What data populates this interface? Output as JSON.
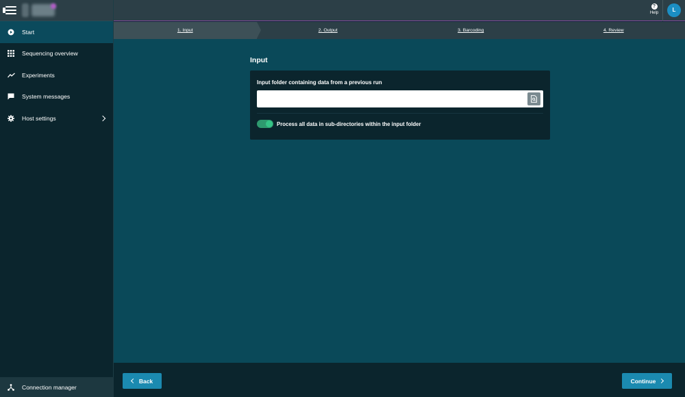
{
  "app": {
    "logo_icon": "blurred-logo"
  },
  "sidebar": {
    "items": [
      {
        "label": "Start",
        "icon": "play-circle-icon",
        "active": true
      },
      {
        "label": "Sequencing overview",
        "icon": "grid-icon"
      },
      {
        "label": "Experiments",
        "icon": "trend-line-icon"
      },
      {
        "label": "System messages",
        "icon": "chat-icon"
      },
      {
        "label": "Host settings",
        "icon": "gear-icon",
        "has_submenu": true
      }
    ],
    "bottom": {
      "label": "Connection manager",
      "icon": "network-icon"
    }
  },
  "header": {
    "help_label": "Help",
    "avatar_initial": "L"
  },
  "stepper": {
    "steps": [
      {
        "label": "1. Input",
        "active": true
      },
      {
        "label": "2. Output"
      },
      {
        "label": "3. Barcoding"
      },
      {
        "label": "4. Review"
      }
    ]
  },
  "main": {
    "section_title": "Input",
    "field_label": "Input folder containing data from a previous run",
    "input_value": "",
    "input_placeholder": "",
    "toggle_label": "Process all data in sub-directories within the input folder",
    "toggle_on": true
  },
  "footer": {
    "back_label": "Back",
    "continue_label": "Continue"
  },
  "colors": {
    "accent": "#1b8ab0",
    "toggle_on": "#36c487",
    "sidebar_bg": "#0b252d",
    "main_bg": "#0a4959"
  }
}
